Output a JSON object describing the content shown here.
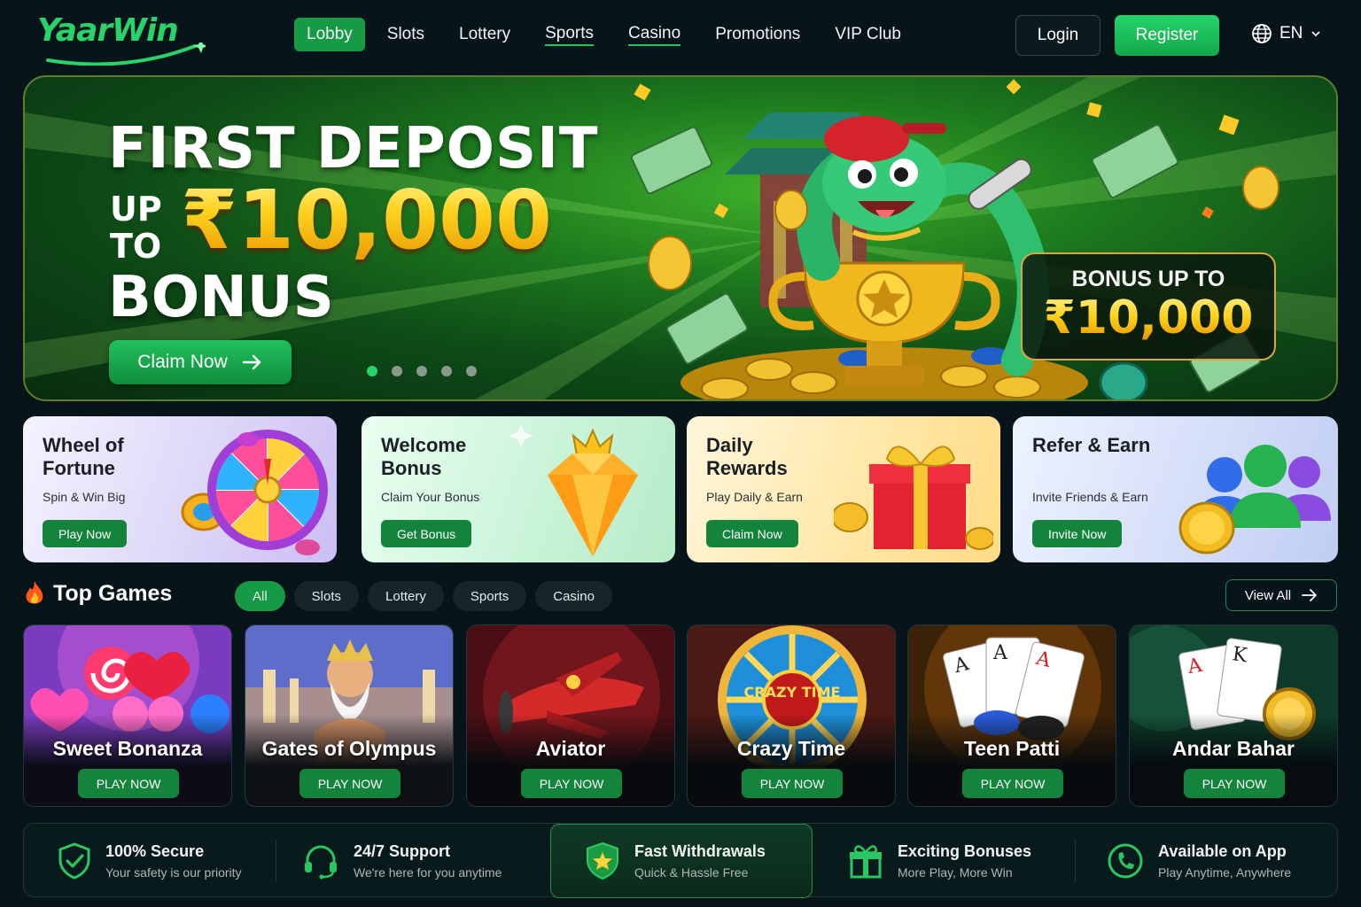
{
  "brand": {
    "name": "YaarWin",
    "accent": "#1fc75a"
  },
  "nav": {
    "items": [
      {
        "label": "Lobby"
      },
      {
        "label": "Slots"
      },
      {
        "label": "Lottery"
      },
      {
        "label": "Sports"
      },
      {
        "label": "Casino"
      },
      {
        "label": "Promotions"
      },
      {
        "label": "VIP Club"
      }
    ],
    "active_item": "Lobby",
    "login": "Login",
    "register": "Register",
    "language": "EN"
  },
  "hero": {
    "headline": "FIRST DEPOSIT",
    "up": "UP",
    "to": "TO",
    "amount": "₹10,000",
    "bonus": "BONUS",
    "cta": "Claim Now",
    "slide_count": 5,
    "active_slide": 1,
    "badge_label": "BONUS UP TO",
    "badge_amount": "₹10,000"
  },
  "promos": [
    {
      "title": "Wheel of Fortune",
      "subtitle": "Spin & Win Big",
      "button": "Play Now",
      "icon": "prize-wheel-icon"
    },
    {
      "title": "Welcome Bonus",
      "subtitle": "Claim Your Bonus",
      "button": "Get Bonus",
      "icon": "crowned-diamond-icon"
    },
    {
      "title": "Daily Rewards",
      "subtitle": "Play Daily & Earn",
      "button": "Claim Now",
      "icon": "gift-box-icon"
    },
    {
      "title": "Refer & Earn",
      "subtitle": "Invite Friends & Earn",
      "button": "Invite Now",
      "icon": "friends-group-icon"
    }
  ],
  "top_games": {
    "title": "Top Games",
    "filters": [
      "All",
      "Slots",
      "Lottery",
      "Sports",
      "Casino"
    ],
    "active_filter": "All",
    "view_all": "View All",
    "games": [
      {
        "name": "Sweet Bonanza",
        "button": "PLAY NOW"
      },
      {
        "name": "Gates of Olympus",
        "button": "PLAY NOW"
      },
      {
        "name": "Aviator",
        "button": "PLAY NOW"
      },
      {
        "name": "Crazy Time",
        "button": "PLAY NOW",
        "art_text": "CRAZY TIME"
      },
      {
        "name": "Teen Patti",
        "button": "PLAY NOW"
      },
      {
        "name": "Andar Bahar",
        "button": "PLAY NOW"
      }
    ]
  },
  "features": [
    {
      "title": "100% Secure",
      "subtitle": "Your safety is our priority",
      "icon": "shield-check-icon"
    },
    {
      "title": "24/7 Support",
      "subtitle": "We're here for you anytime",
      "icon": "headset-icon"
    },
    {
      "title": "Fast Withdrawals",
      "subtitle": "Quick & Hassle Free",
      "icon": "star-shield-icon"
    },
    {
      "title": "Exciting Bonuses",
      "subtitle": "More Play, More Win",
      "icon": "gift-icon"
    },
    {
      "title": "Available on App",
      "subtitle": "Play Anytime, Anywhere",
      "icon": "phone-icon"
    }
  ]
}
